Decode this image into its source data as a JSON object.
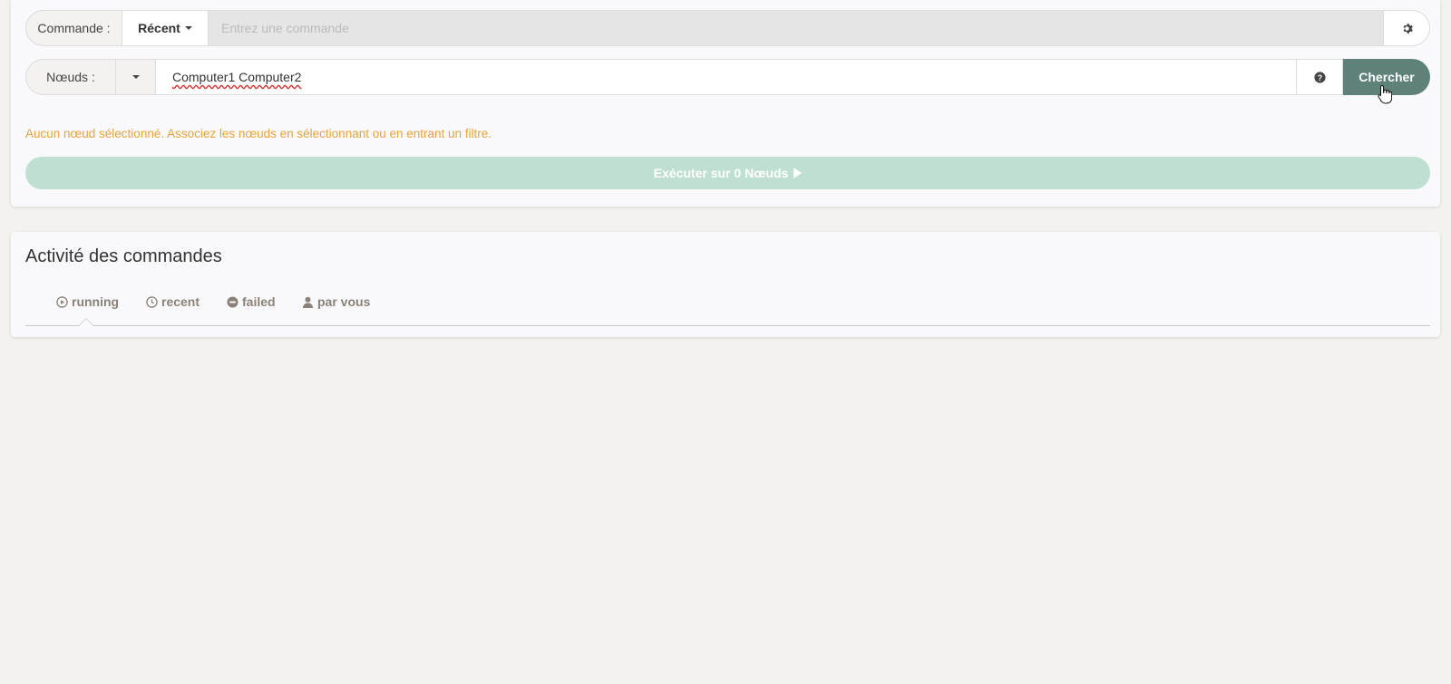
{
  "command_row": {
    "label": "Commande :",
    "recent_button": "Récent",
    "input_placeholder": "Entrez une commande",
    "settings_icon": "gear-icon"
  },
  "nodes_row": {
    "label": "Nœuds :",
    "input_value": "Computer1 Computer2",
    "help_icon": "question-circle-icon",
    "search_button": "Chercher"
  },
  "warning": "Aucun nœud sélectionné. Associez les nœuds en sélectionnant ou en entrant un filtre.",
  "execute_button": "Exécuter sur 0 Nœuds",
  "activity": {
    "title": "Activité des commandes",
    "tabs": [
      {
        "label": "running",
        "icon": "play-circle-icon"
      },
      {
        "label": "recent",
        "icon": "clock-icon"
      },
      {
        "label": "failed",
        "icon": "minus-circle-icon"
      },
      {
        "label": "par vous",
        "icon": "user-icon"
      }
    ]
  },
  "colors": {
    "search_button": "#5e8278",
    "execute_button": "#bfe0d1",
    "warning": "#e9a33b"
  }
}
